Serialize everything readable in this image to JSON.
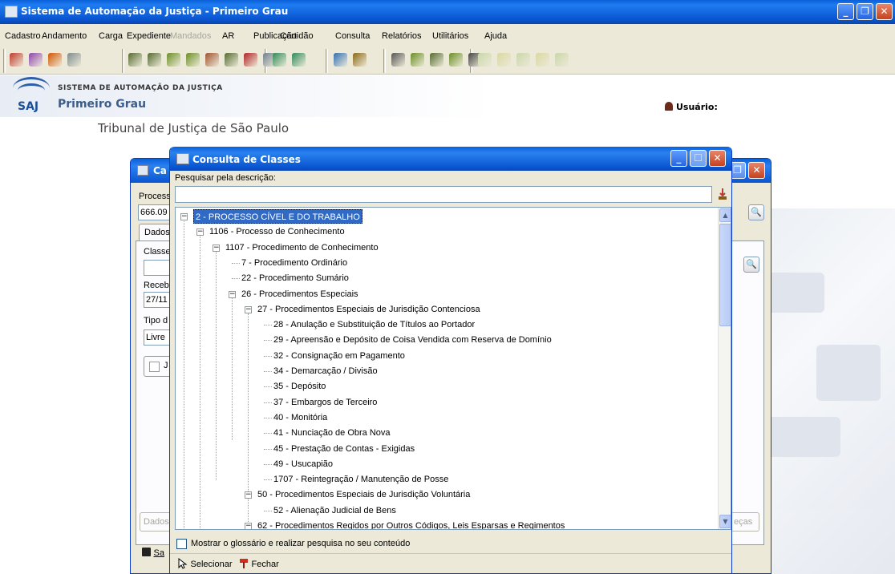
{
  "app": {
    "title": "Sistema de Automação da Justiça - Primeiro Grau",
    "menu": [
      {
        "label": "Cadastro",
        "disabled": false
      },
      {
        "label": "Andamento",
        "disabled": false
      },
      {
        "label": "Carga",
        "disabled": false
      },
      {
        "label": "Expediente",
        "disabled": false
      },
      {
        "label": "Mandados",
        "disabled": true
      },
      {
        "label": "AR",
        "disabled": false
      },
      {
        "label": "Publicação",
        "disabled": false
      },
      {
        "label": "Certidão",
        "disabled": false
      },
      {
        "label": "Consulta",
        "disabled": false
      },
      {
        "label": "Relatórios",
        "disabled": false
      },
      {
        "label": "Utilitários",
        "disabled": false
      },
      {
        "label": "Ajuda",
        "disabled": false
      }
    ],
    "window_controls": {
      "minimize": "_",
      "restore": "❐",
      "close": "✕"
    }
  },
  "banner": {
    "system_name": "SISTEMA DE AUTOMAÇÃO DA JUSTIÇA",
    "module": "Primeiro Grau",
    "logo_text": "SAJ",
    "court": "Tribunal de Justiça de São Paulo",
    "user_label": "Usuário:"
  },
  "background_window": {
    "title": "Ca",
    "processo_label": "Process",
    "processo_value": "666.09",
    "tab_label": "Dados",
    "classe_label": "Classe",
    "recebimento_label": "Receb",
    "recebimento_value": "27/11",
    "tipo_label": "Tipo d",
    "tipo_value": "Livre",
    "checkbox_label": "J",
    "bottom_button": "Dados",
    "bottom_right_button": "eças",
    "save_label": "Sa"
  },
  "dialog": {
    "title": "Consulta de Classes",
    "search_label": "Pesquisar pela descrição:",
    "search_value": "",
    "tree": [
      {
        "label": "2 - PROCESSO CÍVEL E DO TRABALHO",
        "level": 0,
        "expander": "−",
        "selected": true
      },
      {
        "label": "1106 - Processo de Conhecimento",
        "level": 1,
        "expander": "−"
      },
      {
        "label": "1107 - Procedimento de Conhecimento",
        "level": 2,
        "expander": "−"
      },
      {
        "label": "7 - Procedimento Ordinário",
        "level": 3,
        "expander": ""
      },
      {
        "label": "22 - Procedimento Sumário",
        "level": 3,
        "expander": ""
      },
      {
        "label": "26 - Procedimentos Especiais",
        "level": 3,
        "expander": "−"
      },
      {
        "label": "27 - Procedimentos Especiais de Jurisdição Contenciosa",
        "level": 4,
        "expander": "−"
      },
      {
        "label": "28 - Anulação e Substituição de Títulos ao Portador",
        "level": 5,
        "expander": ""
      },
      {
        "label": "29 - Apreensão e Depósito de Coisa Vendida com Reserva de Domínio",
        "level": 5,
        "expander": ""
      },
      {
        "label": "32 - Consignação em Pagamento",
        "level": 5,
        "expander": ""
      },
      {
        "label": "34 - Demarcação / Divisão",
        "level": 5,
        "expander": ""
      },
      {
        "label": "35 - Depósito",
        "level": 5,
        "expander": ""
      },
      {
        "label": "37 - Embargos de Terceiro",
        "level": 5,
        "expander": ""
      },
      {
        "label": "40 - Monitória",
        "level": 5,
        "expander": ""
      },
      {
        "label": "41 - Nunciação de Obra Nova",
        "level": 5,
        "expander": ""
      },
      {
        "label": "45 - Prestação de Contas - Exigidas",
        "level": 5,
        "expander": ""
      },
      {
        "label": "49 - Usucapião",
        "level": 5,
        "expander": ""
      },
      {
        "label": "1707 - Reintegração / Manutenção de Posse",
        "level": 5,
        "expander": ""
      },
      {
        "label": "50 - Procedimentos Especiais de Jurisdição Voluntária",
        "level": 4,
        "expander": "−"
      },
      {
        "label": "52 - Alienação Judicial de Bens",
        "level": 5,
        "expander": ""
      },
      {
        "label": "62 - Procedimentos Regidos por Outros Códigos, Leis Esparsas e Regimentos",
        "level": 4,
        "expander": "−"
      }
    ],
    "glossary_checkbox": "Mostrar o glossário e realizar pesquisa no seu conteúdo",
    "select_button": "Selecionar",
    "close_button": "Fechar"
  },
  "colors": {
    "xp_title": "#0a55d0",
    "selection": "#316ac5",
    "window_bg": "#ece9d8"
  },
  "icons": [
    "pin-icon",
    "tool-icon",
    "print-icon",
    "search-icon",
    "arrow-icon",
    "folder-icon"
  ]
}
